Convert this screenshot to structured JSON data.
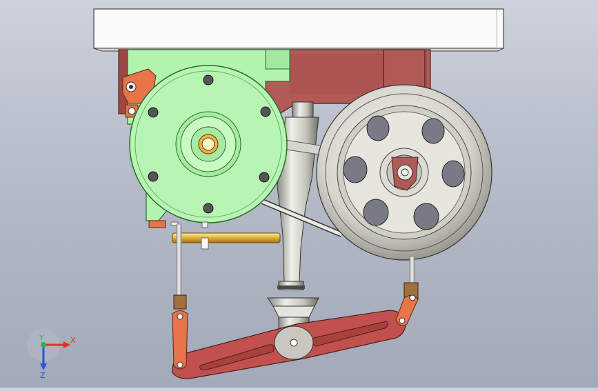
{
  "viewport": {
    "background_top": "#cdd2dc",
    "background_bottom": "#a2a9b8"
  },
  "triad": {
    "x_label": "X",
    "y_label": "Y",
    "z_label": "Z",
    "x_color": "#e0302a",
    "y_color": "#2bb54a",
    "z_color": "#3050d8"
  },
  "parts": {
    "top_plate": "#fbfbfb",
    "motor_body": "#b4f5b0",
    "frame": "#b05a58",
    "bracket": "#e8744a",
    "pulley": "#d8d8d0",
    "column": "#c8c8c0",
    "brass_rod": "#e0b040",
    "lever": "#c05050",
    "link": "#e8744a"
  }
}
